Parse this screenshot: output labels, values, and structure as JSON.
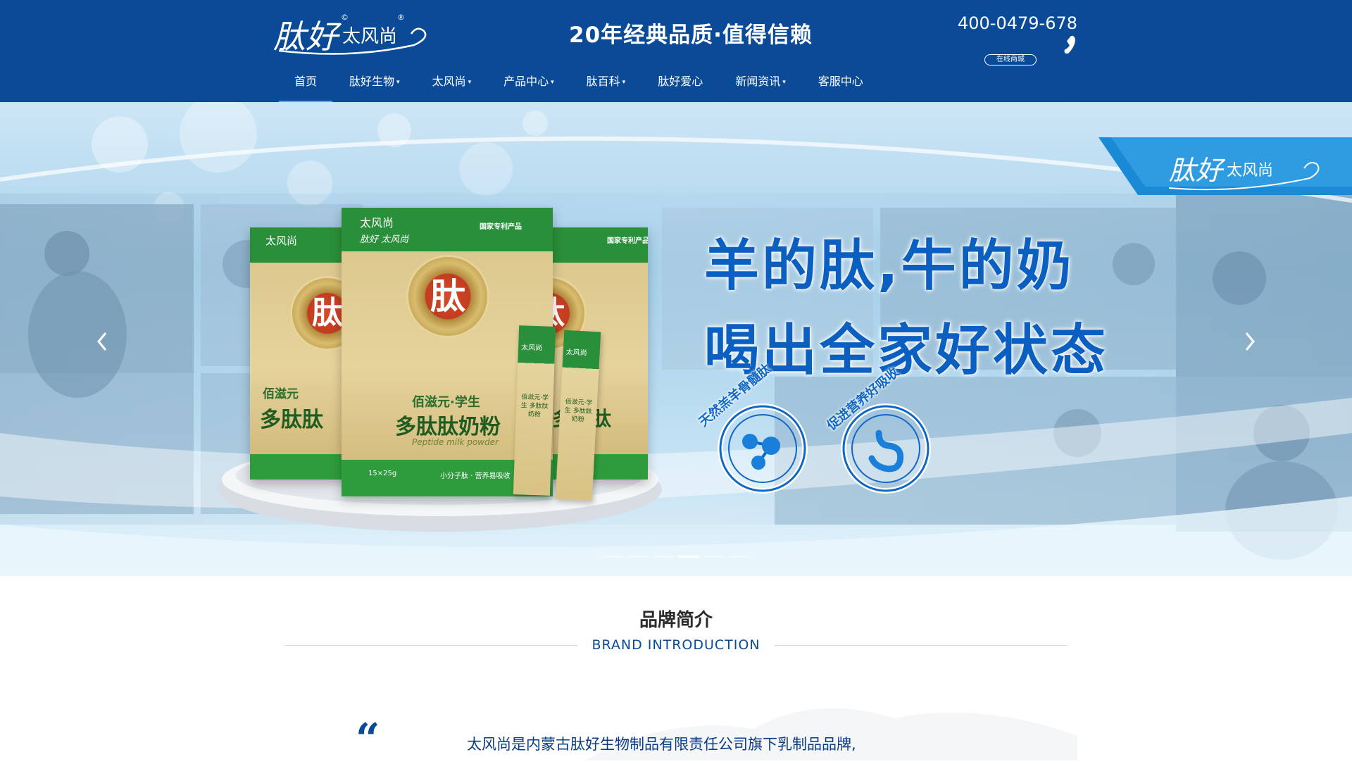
{
  "header": {
    "logo_main": "肽好",
    "logo_sub": "太风尚",
    "logo_mark_c": "©",
    "logo_mark_r": "®",
    "slogan": "20年经典品质·值得信赖",
    "phone": "400-0479-678",
    "shop_button": "在线商城",
    "phone_icon": "phone-icon"
  },
  "nav": {
    "items": [
      {
        "label": "首页",
        "active": true,
        "dropdown": false
      },
      {
        "label": "肽好生物",
        "dropdown": true
      },
      {
        "label": "太风尚",
        "dropdown": true
      },
      {
        "label": "产品中心",
        "dropdown": true
      },
      {
        "label": "肽百科",
        "dropdown": true
      },
      {
        "label": "肽好爱心",
        "dropdown": false
      },
      {
        "label": "新闻资讯",
        "dropdown": true
      },
      {
        "label": "客服中心",
        "dropdown": false
      }
    ],
    "caret": "▾"
  },
  "banner": {
    "headline_1": "羊的肽,牛的奶",
    "headline_2": "喝出全家好状态",
    "badge_1": "天然羔羊骨髓肽",
    "badge_2": "促进营养好吸收",
    "logo_main": "肽好",
    "logo_sub": "太风尚",
    "product": {
      "brand": "太风尚",
      "brand_sub": "肽好 太风尚",
      "patent": "国家专利产品",
      "seal_char": "肽",
      "title_small": "佰滋元·学生",
      "title": "多肽肽奶粉",
      "subtitle": "Peptide milk powder",
      "foot": "小分子肽 · 营养易吸收",
      "net_weight": "15×25g",
      "side_small": "佰滋元",
      "side_title": "多肽肽"
    },
    "stick": {
      "brand": "太风尚",
      "text": "佰滋元·学生 多肽肽奶粉"
    },
    "slide_count": 6,
    "active_slide": 3,
    "colors": {
      "headline": "#0a5fc0",
      "box_green": "#2a8f3a",
      "box_gold": "#d9c58a"
    }
  },
  "brand_intro": {
    "title": "品牌简介",
    "subtitle": "BRAND INTRODUCTION",
    "quote": "“",
    "text": "太风尚是内蒙古肽好生物制品有限责任公司旗下乳制品品牌,"
  },
  "colors": {
    "primary": "#0a4a97",
    "accent": "#5aa7e8"
  }
}
